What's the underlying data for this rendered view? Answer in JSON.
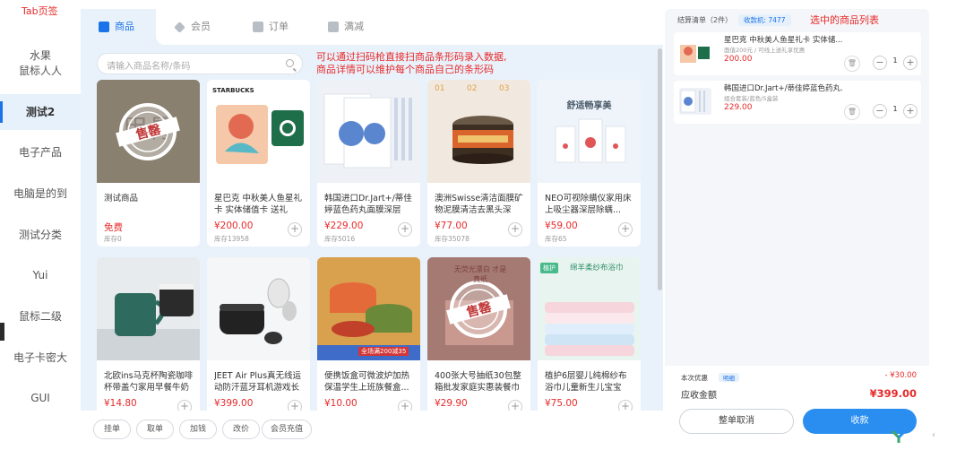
{
  "sidebar": {
    "annotation": "Tab页签",
    "items": [
      {
        "label": "水果"
      },
      {
        "label": "鼠标人人"
      },
      {
        "label": "测试2",
        "active": true
      },
      {
        "label": "电子产品"
      },
      {
        "label": "电脑是的到"
      },
      {
        "label": "测试分类"
      },
      {
        "label": "Yui"
      },
      {
        "label": "鼠标二级"
      },
      {
        "label": "电子卡密大"
      },
      {
        "label": "GUI"
      }
    ]
  },
  "tabs": [
    {
      "label": "商品",
      "icon": "shop-icon",
      "active": true
    },
    {
      "label": "会员",
      "icon": "member-icon"
    },
    {
      "label": "订单",
      "icon": "order-icon"
    },
    {
      "label": "满减",
      "icon": "discount-icon"
    }
  ],
  "search": {
    "placeholder": "请输入商品名称/条码"
  },
  "notes": {
    "scan_line1": "可以通过扫码枪直接扫商品条形码录入数据,",
    "scan_line2": "商品详情可以维护每个商品自己的条形码",
    "cart_note": "选中的商品列表"
  },
  "products": [
    {
      "name": "测试商品",
      "price": "免费",
      "stock": "库存0",
      "image": "sold-out",
      "sold_out_text": "售罄",
      "show_add": false
    },
    {
      "name": "星巴克 中秋美人鱼星礼卡 实体储值卡 送礼礼...",
      "price": "¥200.00",
      "stock": "库存13958",
      "image": "starbucks",
      "brand": "STARBUCKS",
      "show_add": true
    },
    {
      "name": "韩国进口Dr.Jart+/蒂佳婷蓝色药丸面膜深层补...",
      "price": "¥229.00",
      "stock": "库存5016",
      "image": "mask",
      "show_add": true
    },
    {
      "name": "澳洲Swisse清洁面膜矿物泥膜清洁去黑头深层...",
      "price": "¥77.00",
      "stock": "库存35078",
      "image": "swisse",
      "show_add": true
    },
    {
      "name": "NEO可视除螨仪家用床上吸尘器深层除螨...",
      "price": "¥59.00",
      "stock": "库存65",
      "image": "neo",
      "banner": "舒适畅享美",
      "show_add": true
    },
    {
      "name": "北欧ins马克杯陶瓷咖啡杯带盖勺家用早餐牛奶杯...",
      "price": "¥14.80",
      "stock": "",
      "image": "mug",
      "show_add": true
    },
    {
      "name": "JEET Air Plus真无线运动防汗蓝牙耳机游戏长续...",
      "price": "¥399.00",
      "stock": "",
      "image": "earbuds",
      "show_add": true
    },
    {
      "name": "便携饭盒可微波炉加热保温学生上班族餐盒...",
      "price": "¥10.00",
      "stock": "",
      "image": "lunchbox",
      "promo": "全场满200减35",
      "show_add": true
    },
    {
      "name": "400张大号抽纸30包整箱批发家庭实惠装餐巾纸家...",
      "price": "¥29.90",
      "stock": "",
      "image": "sold-out-2",
      "sold_out_text": "售罄",
      "overlay": "无荧光漂白 才是真纸",
      "show_add": true
    },
    {
      "name": "植护6层婴儿纯棉纱布浴巾儿童新生儿宝宝浴...",
      "price": "¥75.00",
      "stock": "",
      "image": "towel",
      "brand": "植护",
      "banner": "绵羊柔纱布浴巾",
      "show_add": true
    }
  ],
  "bottom_actions": [
    "挂单",
    "取单",
    "加钱",
    "改价",
    "会员充值"
  ],
  "cart": {
    "title": "结算清单（2件）",
    "badge": "收款机: 7477",
    "items": [
      {
        "name": "星巴克 中秋美人鱼星礼卡 实体储...",
        "sub": "面值200元 / 可线上送礼享优惠",
        "price": "200.00",
        "qty": "1",
        "image": "starbucks"
      },
      {
        "name": "韩国进口Dr.Jart+/蒂佳婷蓝色药丸...",
        "sub": "组合套装/蓝色/5盒装",
        "price": "229.00",
        "qty": "1",
        "image": "mask"
      }
    ],
    "discount_label": "本次优惠",
    "discount_tag": "明细",
    "discount_value": "- ¥30.00",
    "receivable_label": "应收金额",
    "receivable_value": "¥399.00",
    "cancel_label": "整单取消",
    "pay_label": "收款"
  },
  "colors": {
    "accent": "#1a73e8",
    "price": "#e82a2a",
    "panel_bg": "#e9f2fb",
    "pay": "#2a8ef0"
  }
}
